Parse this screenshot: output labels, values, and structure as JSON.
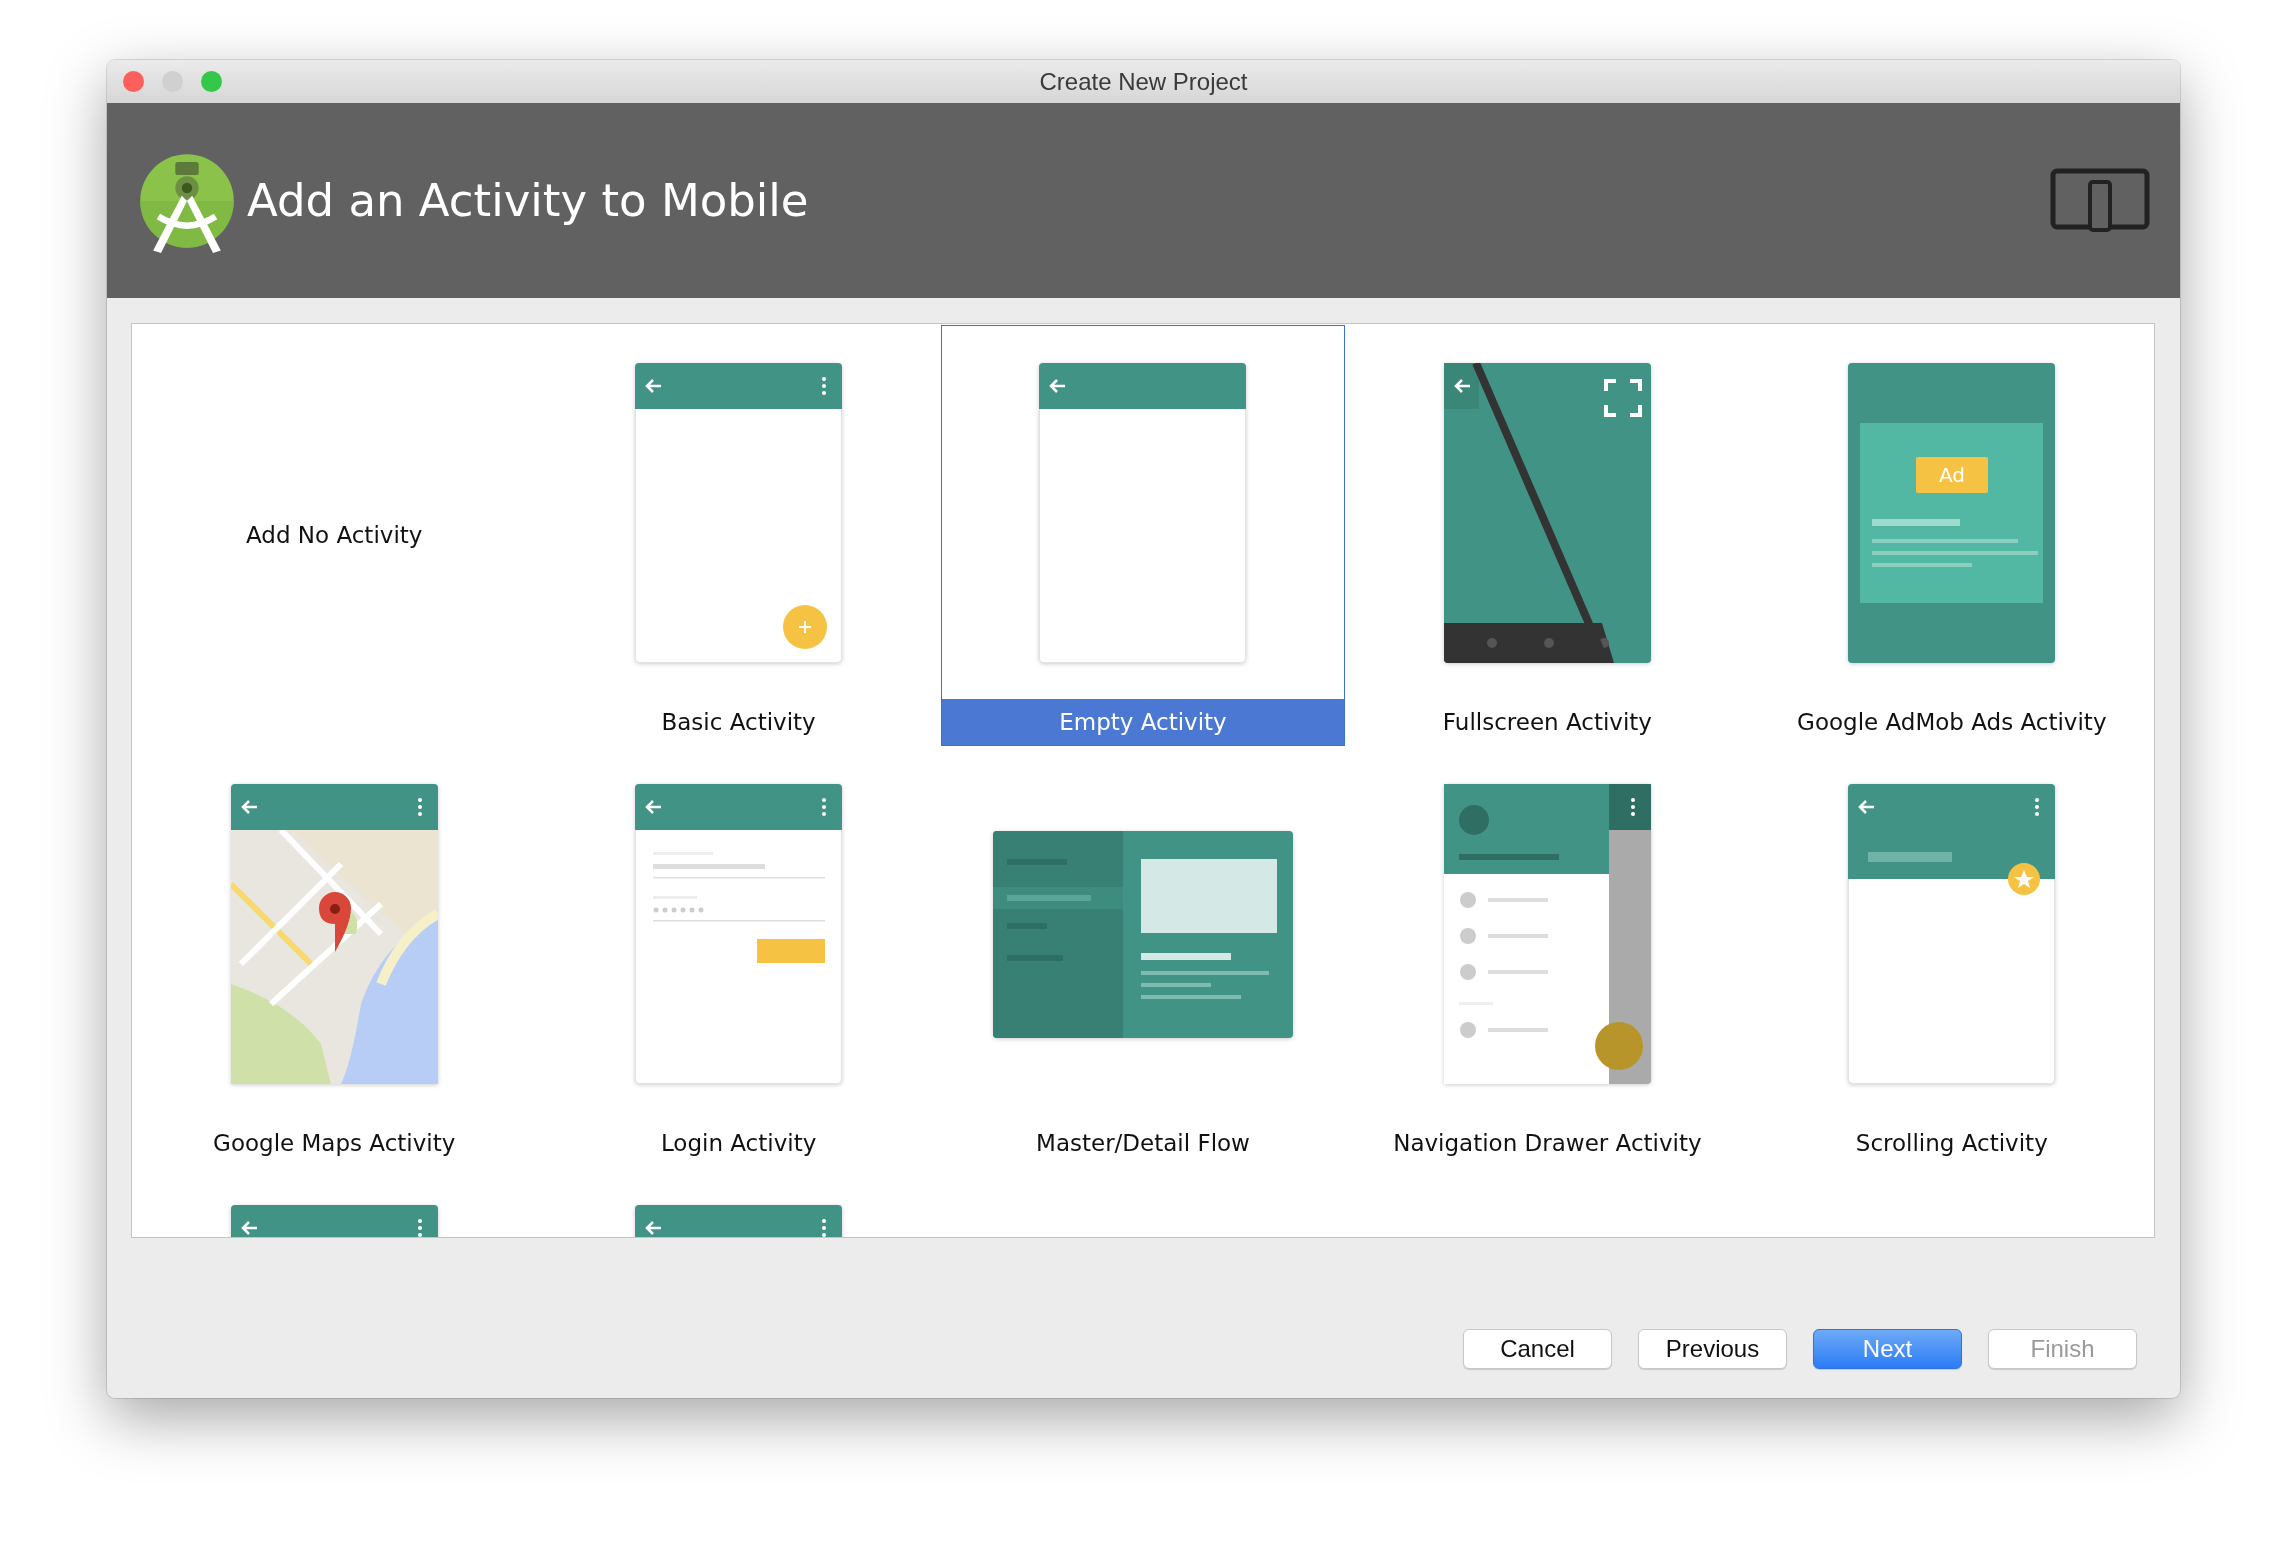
{
  "window": {
    "title": "Create New Project"
  },
  "header": {
    "title": "Add an Activity to Mobile"
  },
  "templates": [
    {
      "kind": "none",
      "label": "Add No Activity",
      "selected": false
    },
    {
      "kind": "basic",
      "label": "Basic Activity",
      "selected": false
    },
    {
      "kind": "empty",
      "label": "Empty Activity",
      "selected": true
    },
    {
      "kind": "fullscreen",
      "label": "Fullscreen Activity",
      "selected": false
    },
    {
      "kind": "admob",
      "label": "Google AdMob Ads Activity",
      "badge": "Ad",
      "selected": false
    },
    {
      "kind": "maps",
      "label": "Google Maps Activity",
      "selected": false
    },
    {
      "kind": "login",
      "label": "Login Activity",
      "selected": false
    },
    {
      "kind": "masterdetail",
      "label": "Master/Detail Flow",
      "selected": false
    },
    {
      "kind": "navdrawer",
      "label": "Navigation Drawer Activity",
      "selected": false
    },
    {
      "kind": "scrolling",
      "label": "Scrolling Activity",
      "selected": false
    },
    {
      "kind": "basic",
      "selected": false
    },
    {
      "kind": "basic",
      "selected": false
    }
  ],
  "buttons": [
    {
      "label": "Cancel",
      "primary": false,
      "disabled": false
    },
    {
      "label": "Previous",
      "primary": false,
      "disabled": false
    },
    {
      "label": "Next",
      "primary": true,
      "disabled": false
    },
    {
      "label": "Finish",
      "primary": false,
      "disabled": true
    }
  ]
}
